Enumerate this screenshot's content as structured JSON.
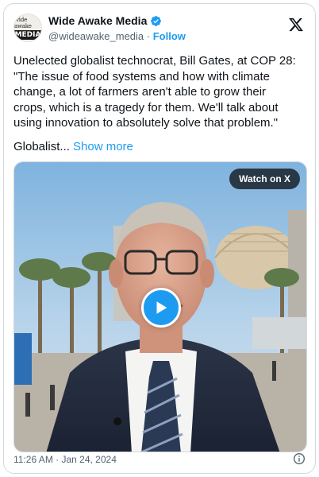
{
  "author": {
    "display_name": "Wide Awake Media",
    "handle": "@wideawake_media",
    "separator": " · ",
    "follow_label": "Follow",
    "avatar_top": "wide awake",
    "avatar_bottom": "MEDIA",
    "verified_icon": "verified-badge-icon"
  },
  "platform_icon": "x-logo-icon",
  "tweet": {
    "text": "Unelected globalist technocrat, Bill Gates, at COP 28:\n\"The issue of food systems and how with climate\nchange, a lot of farmers aren't able to grow their\ncrops, which is a tragedy for them. We'll talk about\nusing innovation to absolutely solve that problem.\"",
    "truncated_text": "Globalist... ",
    "show_more_label": "Show more"
  },
  "media": {
    "watch_label": "Watch on X",
    "play_icon": "play-icon"
  },
  "footer": {
    "timestamp": "11:26 AM · Jan 24, 2024",
    "info_icon": "info-icon"
  },
  "colors": {
    "accent": "#1d9bf0",
    "text": "#0f1419",
    "secondary": "#536471",
    "border": "#cfd9de"
  }
}
